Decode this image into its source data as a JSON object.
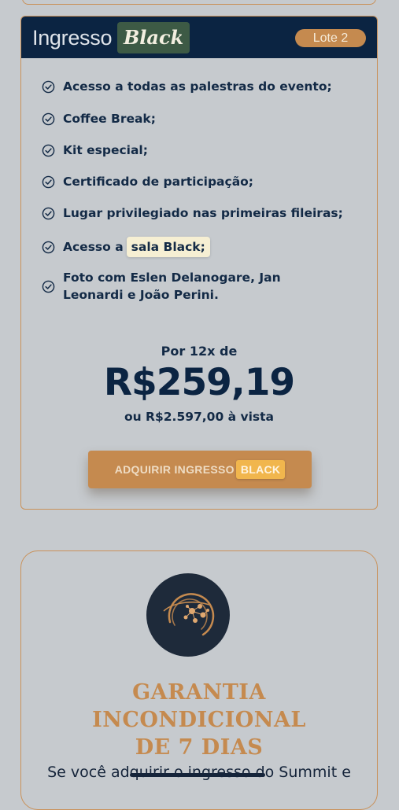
{
  "ticket": {
    "title_plain": "Ingresso",
    "title_highlight": "Black",
    "badge": "Lote 2",
    "features": [
      {
        "text": "Acesso a todas as palestras do evento;"
      },
      {
        "text": "Coffee Break;"
      },
      {
        "text": "Kit especial;"
      },
      {
        "text": "Certificado de participação;"
      },
      {
        "text": "Lugar privilegiado nas primeiras fileiras;"
      },
      {
        "text": "Acesso a",
        "highlight": "sala Black;"
      },
      {
        "line1": "Foto com Eslen Delanogare, Jan",
        "line2": "Leonardi e João Perini."
      }
    ],
    "price_prefix": "Por 12x de",
    "price": "R$259,19",
    "price_vista": "ou R$2.597,00 à vista",
    "cta_plain": "ADQUIRIR INGRESSO",
    "cta_highlight": "BLACK"
  },
  "guarantee": {
    "title_lines": [
      "GARANTIA",
      "INCONDICIONAL",
      "DE 7 DIAS"
    ],
    "text_before": "Se você ad",
    "text_struck": "quirir o ingresso d",
    "text_after": "o Summit e"
  },
  "icons": {
    "check": "check-circle-icon",
    "logo": "network-globe-logo-icon"
  },
  "colors": {
    "navy": "#0b2442",
    "accent": "#c58a4f",
    "background": "#c6cace",
    "highlight": "#f6efd3"
  }
}
